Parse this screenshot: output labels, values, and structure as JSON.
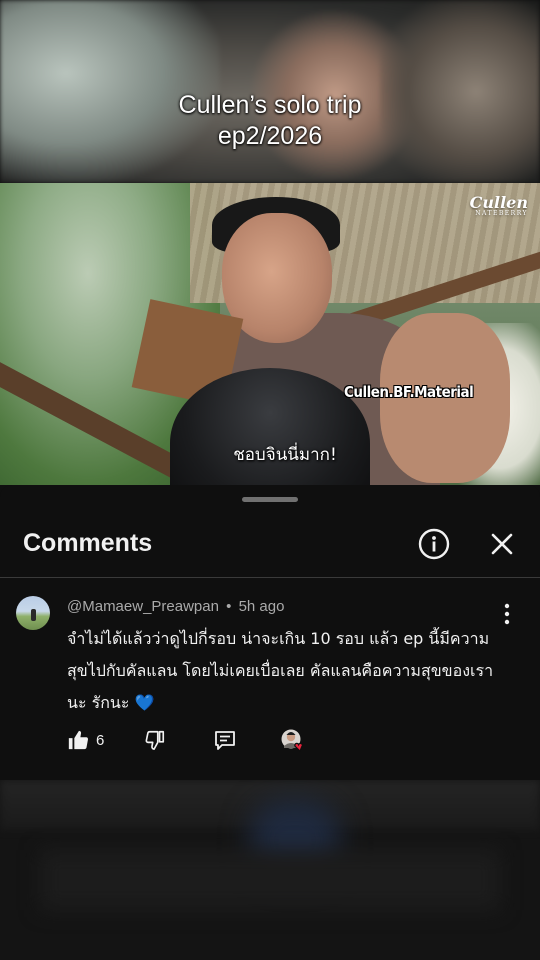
{
  "overlay": {
    "title_line1": "Cullen’s solo trip",
    "title_line2": "ep2/2026"
  },
  "video": {
    "logo_text": "Cullen",
    "logo_sub": "NATEBERRY",
    "watermark": "Cullen.BF.Material",
    "subtitle": "ชอบจินนี่มาก!"
  },
  "comments_sheet": {
    "title": "Comments",
    "info_icon": "info-icon",
    "close_icon": "close-icon",
    "comment": {
      "author": "@Mamaew_Preawpan",
      "separator": "•",
      "time": "5h ago",
      "text": "จำไม่ได้แล้วว่าดูไปกี่รอบ น่าจะเกิน 10 รอบ แล้ว ep นี้มีความสุขไปกับคัลแลน โดยไม่เคยเบื่อเลย คัลแลนคือความสุขของเรานะ รักนะ 💙",
      "like_count": "6",
      "icons": {
        "like": "thumbs-up-icon",
        "dislike": "thumbs-down-icon",
        "reply": "reply-icon",
        "creator_heart": "creator-heart-icon",
        "more": "more-vertical-icon"
      }
    }
  },
  "colors": {
    "sheet_bg": "#0f0f0f",
    "text_primary": "#f1f1f1",
    "text_secondary": "#aaaaaa",
    "heart": "#e8243c"
  }
}
